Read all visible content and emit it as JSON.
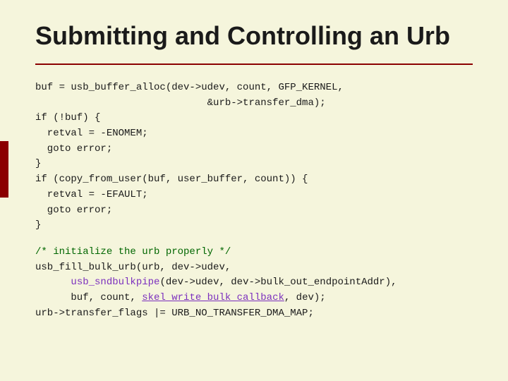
{
  "slide": {
    "title": "Submitting and Controlling an Urb",
    "code_blocks": [
      {
        "id": "block1",
        "lines": [
          {
            "text": "buf = usb_buffer_alloc(dev->udev, count, GFP_KERNEL,",
            "type": "normal"
          },
          {
            "text": "                             &urb->transfer_dma);",
            "type": "normal"
          },
          {
            "text": "if (!buf) {",
            "type": "normal"
          },
          {
            "text": "  retval = -ENOMEM;",
            "type": "normal"
          },
          {
            "text": "  goto error;",
            "type": "normal"
          },
          {
            "text": "}",
            "type": "normal"
          },
          {
            "text": "if (copy_from_user(buf, user_buffer, count)) {",
            "type": "normal"
          },
          {
            "text": "  retval = -EFAULT;",
            "type": "normal"
          },
          {
            "text": "  goto error;",
            "type": "normal"
          },
          {
            "text": "}",
            "type": "normal"
          }
        ]
      },
      {
        "id": "block2",
        "lines": [
          {
            "text": "/* initialize the urb properly */",
            "type": "comment"
          },
          {
            "text": "usb_fill_bulk_urb(urb, dev->udev,",
            "type": "normal"
          },
          {
            "text": "      usb_sndbulkpipe(dev->udev, dev->bulk_out_endpointAddr),",
            "type": "purple"
          },
          {
            "text": "      buf, count, skel_write_bulk_callback, dev);",
            "type": "mixed_green"
          },
          {
            "text": "urb->transfer_flags |= URB_NO_TRANSFER_DMA_MAP;",
            "type": "normal"
          }
        ]
      }
    ],
    "accent_color": "#8b0000"
  }
}
